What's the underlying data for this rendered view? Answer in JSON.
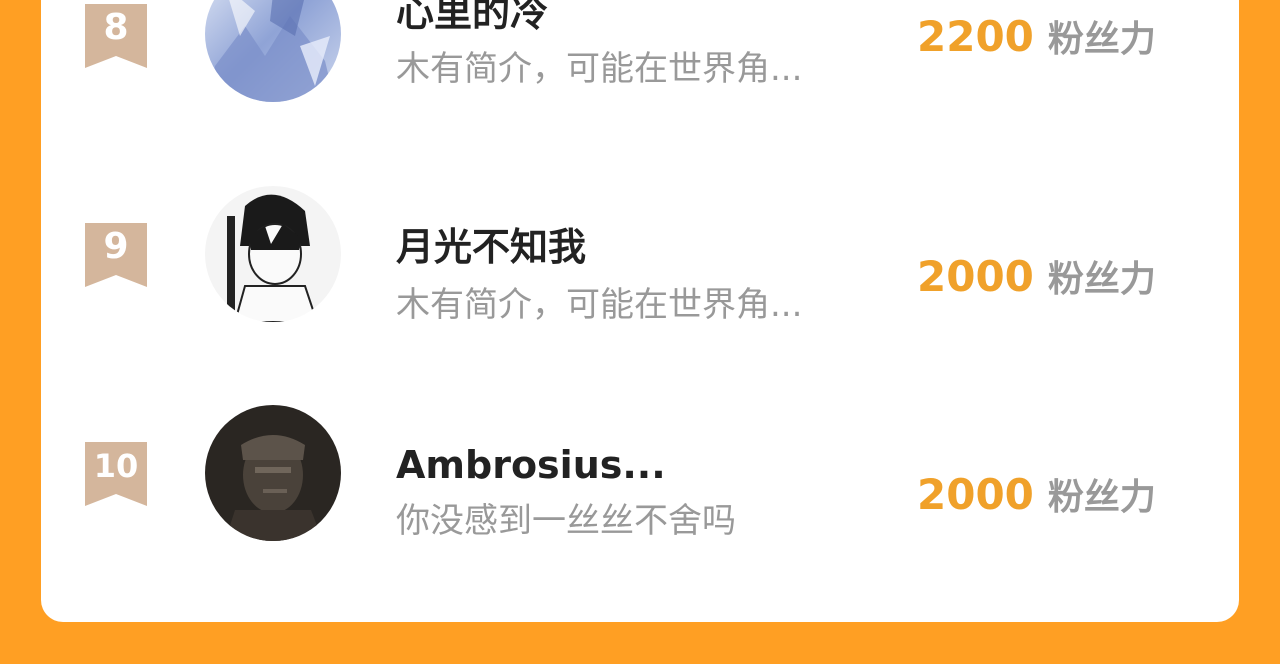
{
  "colors": {
    "background": "#FF9F23",
    "card": "#FFFFFF",
    "rank_badge": "#D4B69C",
    "score": "#F0A12A",
    "name": "#222222",
    "muted": "#999999"
  },
  "rankings": [
    {
      "rank": "8",
      "name": "心里的冷",
      "bio": "木有简介，可能在世界角...",
      "score": "2200",
      "score_unit": "粉丝力",
      "avatar_icon": "anime-blue-avatar"
    },
    {
      "rank": "9",
      "name": "月光不知我",
      "bio": "木有简介，可能在世界角...",
      "score": "2000",
      "score_unit": "粉丝力",
      "avatar_icon": "manga-boy-avatar"
    },
    {
      "rank": "10",
      "name": "Ambrosius...",
      "bio": "你没感到一丝丝不舍吗",
      "score": "2000",
      "score_unit": "粉丝力",
      "avatar_icon": "dark-portrait-avatar"
    }
  ]
}
